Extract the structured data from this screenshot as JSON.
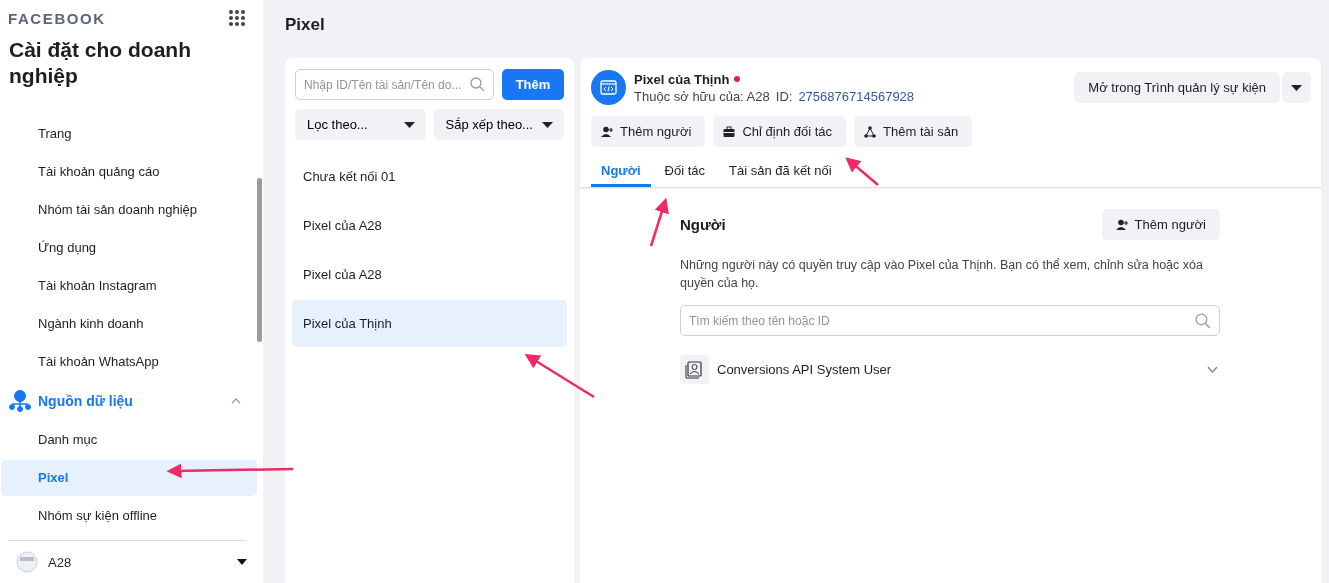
{
  "sidebar": {
    "brand": "FACEBOOK",
    "title": "Cài đặt cho doanh nghiệp",
    "items": [
      {
        "label": "Trang",
        "selected": false
      },
      {
        "label": "Tài khoản quảng cáo",
        "selected": false
      },
      {
        "label": "Nhóm tài sản doanh nghiệp",
        "selected": false
      },
      {
        "label": "Ứng dụng",
        "selected": false
      },
      {
        "label": "Tài khoản Instagram",
        "selected": false
      },
      {
        "label": "Ngành kinh doanh",
        "selected": false
      },
      {
        "label": "Tài khoản WhatsApp",
        "selected": false
      }
    ],
    "section": {
      "label": "Nguồn dữ liệu",
      "expanded": true,
      "items": [
        {
          "label": "Danh mục",
          "selected": false
        },
        {
          "label": "Pixel",
          "selected": true
        },
        {
          "label": "Nhóm sự kiện offline",
          "selected": false
        }
      ]
    },
    "account": "A28"
  },
  "page_title": "Pixel",
  "list_panel": {
    "search": {
      "placeholder": "Nhập ID/Tên tài sản/Tên do..."
    },
    "add_button": "Thêm",
    "filter": "Lọc theo...",
    "sort": "Sắp xếp theo...",
    "items": [
      {
        "label": "Chưa kết nối 01",
        "selected": false
      },
      {
        "label": "Pixel của A28",
        "selected": false
      },
      {
        "label": "Pixel của A28",
        "selected": false
      },
      {
        "label": "Pixel của Thịnh",
        "selected": true
      }
    ]
  },
  "detail": {
    "name": "Pixel của Thịnh",
    "alert": true,
    "owner": "Thuộc sở hữu của: A28",
    "id_label": "ID:",
    "id": "2756876714567928",
    "open_button": "Mở trong Trình quản lý sự kiện",
    "actions": [
      {
        "kind": "person",
        "label": "Thêm người"
      },
      {
        "kind": "partner",
        "label": "Chỉ định đối tác"
      },
      {
        "kind": "asset",
        "label": "Thêm tài sản"
      }
    ],
    "tabs": [
      {
        "label": "Người",
        "selected": true
      },
      {
        "label": "Đối tác",
        "selected": false
      },
      {
        "label": "Tài sản đã kết nối",
        "selected": false
      }
    ],
    "section_title": "Người",
    "add_person_button": "Thêm người",
    "description": "Những người này có quyền truy cập vào Pixel của Thịnh. Bạn có thể xem, chỉnh sửa hoặc xóa quyền của họ.",
    "people_search": {
      "placeholder": "Tìm kiếm theo tên hoặc ID"
    },
    "people": [
      {
        "name": "Conversions API System User",
        "expanded": false
      }
    ]
  }
}
